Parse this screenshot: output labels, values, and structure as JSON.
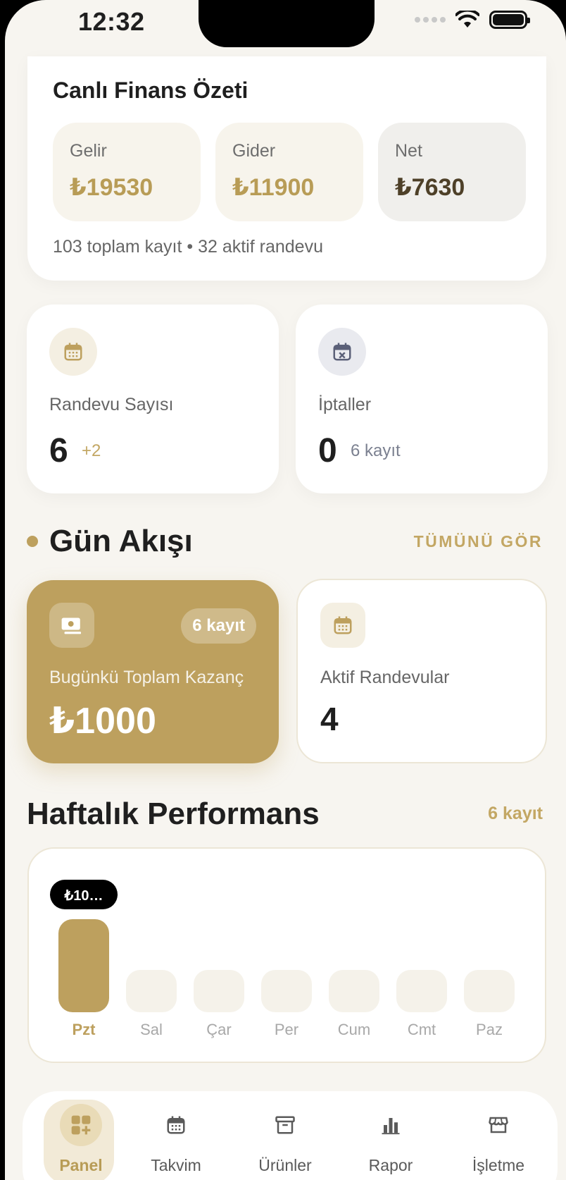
{
  "status_bar": {
    "time": "12:32"
  },
  "finance": {
    "title": "Canlı Finans Özeti",
    "income_label": "Gelir",
    "income_value": "₺19530",
    "expense_label": "Gider",
    "expense_value": "₺11900",
    "net_label": "Net",
    "net_value": "₺7630",
    "note": "103 toplam kayıt • 32 aktif randevu"
  },
  "appointments": {
    "label": "Randevu Sayısı",
    "value": "6",
    "delta": "+2",
    "icon": "calendar-icon"
  },
  "cancellations": {
    "label": "İptaller",
    "value": "0",
    "sub": "6 kayıt",
    "icon": "calendar-x-icon"
  },
  "day_flow": {
    "title": "Gün Akışı",
    "see_all": "TÜMÜNÜ GÖR",
    "earnings": {
      "badge": "6 kayıt",
      "label": "Bugünkü Toplam Kazanç",
      "value": "₺1000",
      "icon": "cash-icon"
    },
    "active": {
      "label": "Aktif Randevular",
      "value": "4",
      "icon": "calendar-icon"
    }
  },
  "weekly": {
    "title": "Haftalık Performans",
    "count": "6 kayıt"
  },
  "chart_data": {
    "type": "bar",
    "categories": [
      "Pzt",
      "Sal",
      "Çar",
      "Per",
      "Cum",
      "Cmt",
      "Paz"
    ],
    "values": [
      1000,
      0,
      0,
      0,
      0,
      0,
      0
    ],
    "highlight_label": "₺10…",
    "highlight_index": 0,
    "colors": {
      "active": "#bda05e",
      "inactive": "#f5f2ea",
      "tooltip": "#000000"
    }
  },
  "nav": {
    "items": [
      {
        "label": "Panel",
        "icon": "dashboard-add-icon",
        "active": true
      },
      {
        "label": "Takvim",
        "icon": "calendar-icon",
        "active": false
      },
      {
        "label": "Ürünler",
        "icon": "archive-box-icon",
        "active": false
      },
      {
        "label": "Rapor",
        "icon": "bar-chart-icon",
        "active": false
      },
      {
        "label": "İşletme",
        "icon": "store-icon",
        "active": false
      }
    ]
  },
  "colors": {
    "accent": "#bda05e",
    "background": "#f7f5f0",
    "card": "#ffffff"
  }
}
